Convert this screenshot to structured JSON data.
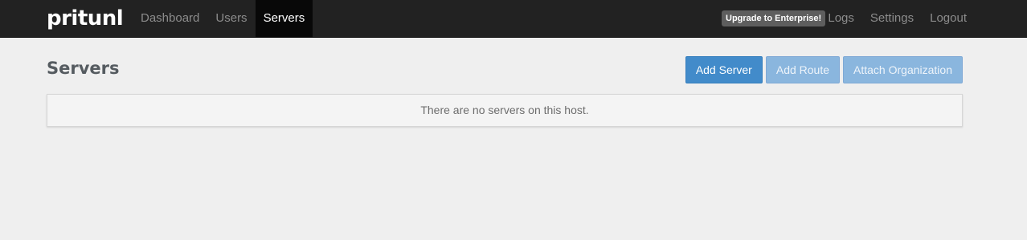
{
  "navbar": {
    "brand": "pritunl",
    "left_items": [
      {
        "label": "Dashboard",
        "active": false
      },
      {
        "label": "Users",
        "active": false
      },
      {
        "label": "Servers",
        "active": true
      }
    ],
    "upgrade_label": "Upgrade to Enterprise!",
    "right_items": [
      {
        "label": "Logs"
      },
      {
        "label": "Settings"
      },
      {
        "label": "Logout"
      }
    ]
  },
  "page": {
    "title": "Servers",
    "actions": {
      "add_server": "Add Server",
      "add_route": "Add Route",
      "attach_organization": "Attach Organization"
    },
    "empty_message": "There are no servers on this host."
  },
  "colors": {
    "navbar_bg": "#222222",
    "active_nav_bg": "#080808",
    "primary": "#428bca",
    "primary_disabled": "#8ab6de",
    "page_bg": "#efefef"
  }
}
